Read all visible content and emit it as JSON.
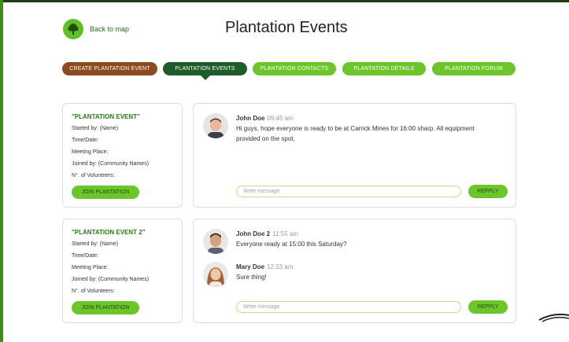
{
  "header": {
    "back_label": "Back to map",
    "title": "Plantation Events"
  },
  "tabs": [
    {
      "label": "CREATE PLANTATION EVENT",
      "state": "create"
    },
    {
      "label": "PLANTATION EVENTS",
      "state": "active"
    },
    {
      "label": "PLANTATION CONTACTS",
      "state": "default"
    },
    {
      "label": "PLANTATION DETAILS",
      "state": "default"
    },
    {
      "label": "PLANTATION FORUM",
      "state": "default"
    }
  ],
  "events": [
    {
      "title": "\"PLANTATION EVENT\"",
      "started_by": "Started by: (Name)",
      "time_date": "Time/Date:",
      "meeting_place": "Meeting Place:",
      "joined_by": "Joined by: (Community Names)",
      "volunteers": "N°. of Volunteers:",
      "join_label": "JOIN PLANTATION"
    },
    {
      "title": "\"PLANTATION EVENT 2\"",
      "started_by": "Started by: (Name)",
      "time_date": "Time/Date:",
      "meeting_place": "Meeting Place:",
      "joined_by": "Joined by: (Community Names)",
      "volunteers": "N°. of Volunteers:",
      "join_label": "JOIN PLANTATION"
    }
  ],
  "chats": [
    {
      "messages": [
        {
          "name": "John Doe",
          "time": "09:45 am",
          "text": "Hi guys, hope everyone is ready to be at Carrick Mines for 16:00 sharp. All equipment provided on the spot."
        }
      ],
      "input_placeholder": "Write message",
      "reply_label": "REPPLY"
    },
    {
      "messages": [
        {
          "name": "John Doe 2",
          "time": "11:55 am",
          "text": "Everyone ready at 15:00 this Saturday?"
        },
        {
          "name": "Mary Doe",
          "time": "12:23 am",
          "text": "Sure thing!"
        }
      ],
      "input_placeholder": "Write message",
      "reply_label": "REPPLY"
    }
  ],
  "colors": {
    "accent_green": "#6cc62a",
    "active_tab": "#1e5c2a",
    "create_tab": "#8b4b1f",
    "title_green": "#2d7a1a"
  },
  "icons": {
    "back": "tree-icon"
  }
}
